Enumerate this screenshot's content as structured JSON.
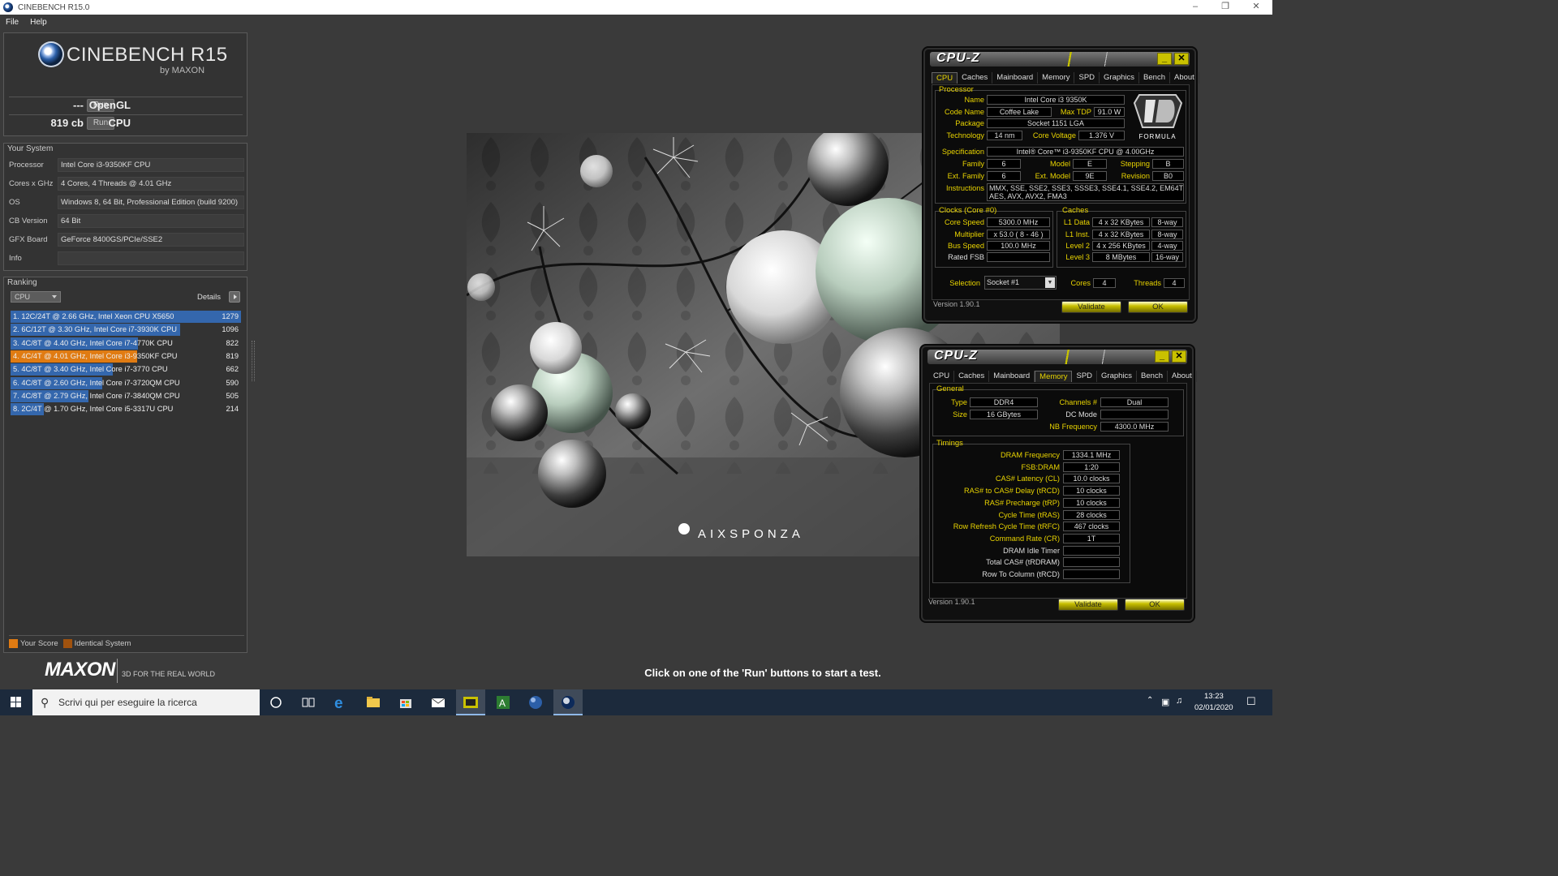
{
  "window": {
    "title": "CINEBENCH R15.0"
  },
  "menu": [
    "File",
    "Help"
  ],
  "logo": {
    "name": "CINEBENCH R15",
    "by": "by MAXON"
  },
  "scores": [
    {
      "label": "OpenGL",
      "value": "---",
      "button": "Run"
    },
    {
      "label": "CPU",
      "value": "819 cb",
      "button": "Run"
    }
  ],
  "your_system": {
    "title": "Your System",
    "rows": [
      {
        "key": "Processor",
        "value": "Intel Core i3-9350KF CPU"
      },
      {
        "key": "Cores x GHz",
        "value": "4 Cores, 4 Threads @ 4.01 GHz"
      },
      {
        "key": "OS",
        "value": "Windows 8, 64 Bit, Professional Edition (build 9200)"
      },
      {
        "key": "CB Version",
        "value": "64 Bit"
      },
      {
        "key": "GFX Board",
        "value": "GeForce 8400GS/PCIe/SSE2"
      },
      {
        "key": "Info",
        "value": ""
      }
    ]
  },
  "ranking": {
    "title": "Ranking",
    "select": "CPU",
    "details": "Details",
    "max_score": 1279,
    "rows": [
      {
        "text": "1. 12C/24T @ 2.66 GHz, Intel Xeon CPU X5650",
        "score": 1279,
        "kind": "other"
      },
      {
        "text": "2. 6C/12T @ 3.30 GHz,  Intel Core i7-3930K CPU",
        "score": 1096,
        "kind": "other"
      },
      {
        "text": "3. 4C/8T @ 4.40 GHz, Intel Core i7-4770K CPU",
        "score": 822,
        "kind": "other"
      },
      {
        "text": "4. 4C/4T @ 4.01 GHz, Intel Core i3-9350KF CPU",
        "score": 819,
        "kind": "yours"
      },
      {
        "text": "5. 4C/8T @ 3.40 GHz,  Intel Core i7-3770 CPU",
        "score": 662,
        "kind": "other"
      },
      {
        "text": "6. 4C/8T @ 2.60 GHz, Intel Core i7-3720QM CPU",
        "score": 590,
        "kind": "other"
      },
      {
        "text": "7. 4C/8T @ 2.79 GHz,  Intel Core i7-3840QM CPU",
        "score": 505,
        "kind": "other"
      },
      {
        "text": "8. 2C/4T @ 1.70 GHz,  Intel Core i5-3317U CPU",
        "score": 214,
        "kind": "other"
      }
    ],
    "legend": [
      {
        "label": "Your Score",
        "color": "#e07b12"
      },
      {
        "label": "Identical System",
        "color": "#a0520e"
      }
    ]
  },
  "maxon": {
    "brand": "MAXON",
    "tagline": "3D FOR THE REAL WORLD"
  },
  "render": {
    "watermark": "AIXSPONZA"
  },
  "status": "Click on one of the 'Run' buttons to start a test.",
  "cpuz_cpu": {
    "title": "CPU-Z",
    "tabs": [
      "CPU",
      "Caches",
      "Mainboard",
      "Memory",
      "SPD",
      "Graphics",
      "Bench",
      "About"
    ],
    "active_tab": "CPU",
    "processor_title": "Processor",
    "name_lbl": "Name",
    "name": "Intel Core i3 9350K",
    "codename_lbl": "Code Name",
    "codename": "Coffee Lake",
    "maxtdp_lbl": "Max TDP",
    "maxtdp": "91.0 W",
    "package_lbl": "Package",
    "package": "Socket 1151 LGA",
    "tech_lbl": "Technology",
    "tech": "14 nm",
    "voltage_lbl": "Core Voltage",
    "voltage": "1.376 V",
    "spec_lbl": "Specification",
    "spec": "Intel® Core™ i3-9350KF CPU @ 4.00GHz",
    "family_lbl": "Family",
    "family": "6",
    "model_lbl": "Model",
    "model": "E",
    "stepping_lbl": "Stepping",
    "stepping": "B",
    "extfamily_lbl": "Ext. Family",
    "extfamily": "6",
    "extmodel_lbl": "Ext. Model",
    "extmodel": "9E",
    "revision_lbl": "Revision",
    "revision": "B0",
    "instr_lbl": "Instructions",
    "instr1": "MMX, SSE, SSE2, SSE3, SSSE3, SSE4.1, SSE4.2, EM64T, VT-x,",
    "instr2": "AES, AVX, AVX2, FMA3",
    "clocks_title": "Clocks (Core #0)",
    "corespeed_lbl": "Core Speed",
    "corespeed": "5300.0 MHz",
    "mult_lbl": "Multiplier",
    "mult": "x 53.0 ( 8 - 46 )",
    "bus_lbl": "Bus Speed",
    "bus": "100.0 MHz",
    "fsb_lbl": "Rated FSB",
    "fsb": "",
    "caches_title": "Caches",
    "l1d_lbl": "L1 Data",
    "l1d": "4 x 32 KBytes",
    "l1d_way": "8-way",
    "l1i_lbl": "L1 Inst.",
    "l1i": "4 x 32 KBytes",
    "l1i_way": "8-way",
    "l2_lbl": "Level 2",
    "l2": "4 x 256 KBytes",
    "l2_way": "4-way",
    "l3_lbl": "Level 3",
    "l3": "8 MBytes",
    "l3_way": "16-way",
    "selection_lbl": "Selection",
    "selection": "Socket #1",
    "cores_lbl": "Cores",
    "cores": "4",
    "threads_lbl": "Threads",
    "threads": "4",
    "version": "Version 1.90.1",
    "validate": "Validate",
    "ok": "OK",
    "badge": "FORMULA"
  },
  "cpuz_mem": {
    "title": "CPU-Z",
    "tabs": [
      "CPU",
      "Caches",
      "Mainboard",
      "Memory",
      "SPD",
      "Graphics",
      "Bench",
      "About"
    ],
    "active_tab": "Memory",
    "general_title": "General",
    "type_lbl": "Type",
    "type": "DDR4",
    "size_lbl": "Size",
    "size": "16 GBytes",
    "channels_lbl": "Channels #",
    "channels": "Dual",
    "dcmode_lbl": "DC Mode",
    "dcmode": "",
    "nbfreq_lbl": "NB Frequency",
    "nbfreq": "4300.0 MHz",
    "timings_title": "Timings",
    "timings": [
      {
        "label": "DRAM Frequency",
        "value": "1334.1 MHz",
        "on": true
      },
      {
        "label": "FSB:DRAM",
        "value": "1:20",
        "on": true
      },
      {
        "label": "CAS# Latency (CL)",
        "value": "10.0 clocks",
        "on": true
      },
      {
        "label": "RAS# to CAS# Delay (tRCD)",
        "value": "10 clocks",
        "on": true
      },
      {
        "label": "RAS# Precharge (tRP)",
        "value": "10 clocks",
        "on": true
      },
      {
        "label": "Cycle Time (tRAS)",
        "value": "28 clocks",
        "on": true
      },
      {
        "label": "Row Refresh Cycle Time (tRFC)",
        "value": "467 clocks",
        "on": true
      },
      {
        "label": "Command Rate (CR)",
        "value": "1T",
        "on": true
      },
      {
        "label": "DRAM Idle Timer",
        "value": "",
        "on": false
      },
      {
        "label": "Total CAS# (tRDRAM)",
        "value": "",
        "on": false
      },
      {
        "label": "Row To Column (tRCD)",
        "value": "",
        "on": false
      }
    ],
    "version": "Version 1.90.1",
    "validate": "Validate",
    "ok": "OK"
  },
  "taskbar": {
    "search_placeholder": "Scrivi qui per eseguire la ricerca",
    "time": "13:23",
    "date": "02/01/2020"
  },
  "colors": {
    "your_score": "#e07b12",
    "ranking_bar": "#3467ad",
    "cpuz_accent": "#e8d300"
  }
}
